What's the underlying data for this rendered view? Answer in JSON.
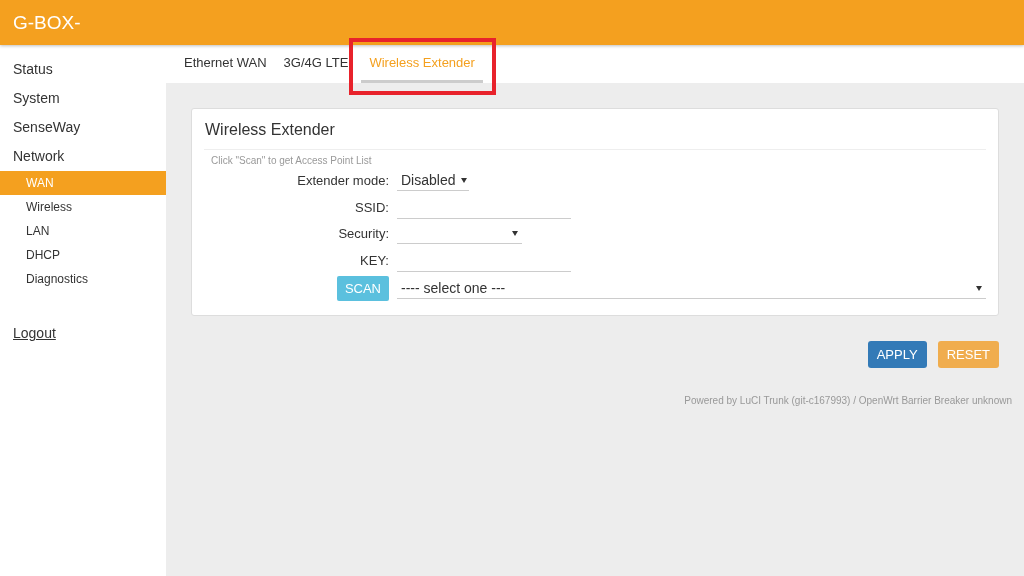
{
  "header": {
    "brand": "G-BOX-"
  },
  "sidebar": {
    "items": [
      {
        "label": "Status",
        "selected": false
      },
      {
        "label": "System",
        "selected": false
      },
      {
        "label": "SenseWay",
        "selected": false
      },
      {
        "label": "Network",
        "selected": false,
        "children": [
          {
            "label": "WAN",
            "selected": true
          },
          {
            "label": "Wireless",
            "selected": false
          },
          {
            "label": "LAN",
            "selected": false
          },
          {
            "label": "DHCP",
            "selected": false
          },
          {
            "label": "Diagnostics",
            "selected": false
          }
        ]
      }
    ],
    "logout": "Logout"
  },
  "tabs": [
    {
      "label": "Ethernet WAN",
      "selected": false,
      "highlighted": false
    },
    {
      "label": "3G/4G LTE",
      "selected": false,
      "highlighted": false
    },
    {
      "label": "Wireless Extender",
      "selected": true,
      "highlighted": true
    }
  ],
  "card": {
    "title": "Wireless Extender",
    "hint": "Click \"Scan\" to get Access Point List",
    "fields": [
      {
        "label": "Extender mode:",
        "kind": "select",
        "value": "Disabled"
      },
      {
        "label": "SSID:",
        "kind": "text"
      },
      {
        "label": "Security:",
        "kind": "select"
      },
      {
        "label": "KEY:",
        "kind": "text"
      }
    ],
    "scan": {
      "button": "SCAN",
      "value": "---- select one ---"
    }
  },
  "buttons": [
    {
      "label": "APPLY",
      "kind": "primary"
    },
    {
      "label": "RESET",
      "kind": "warning"
    }
  ],
  "footer": "Powered by LuCI Trunk (git-c167993) / OpenWrt Barrier Breaker unknown"
}
